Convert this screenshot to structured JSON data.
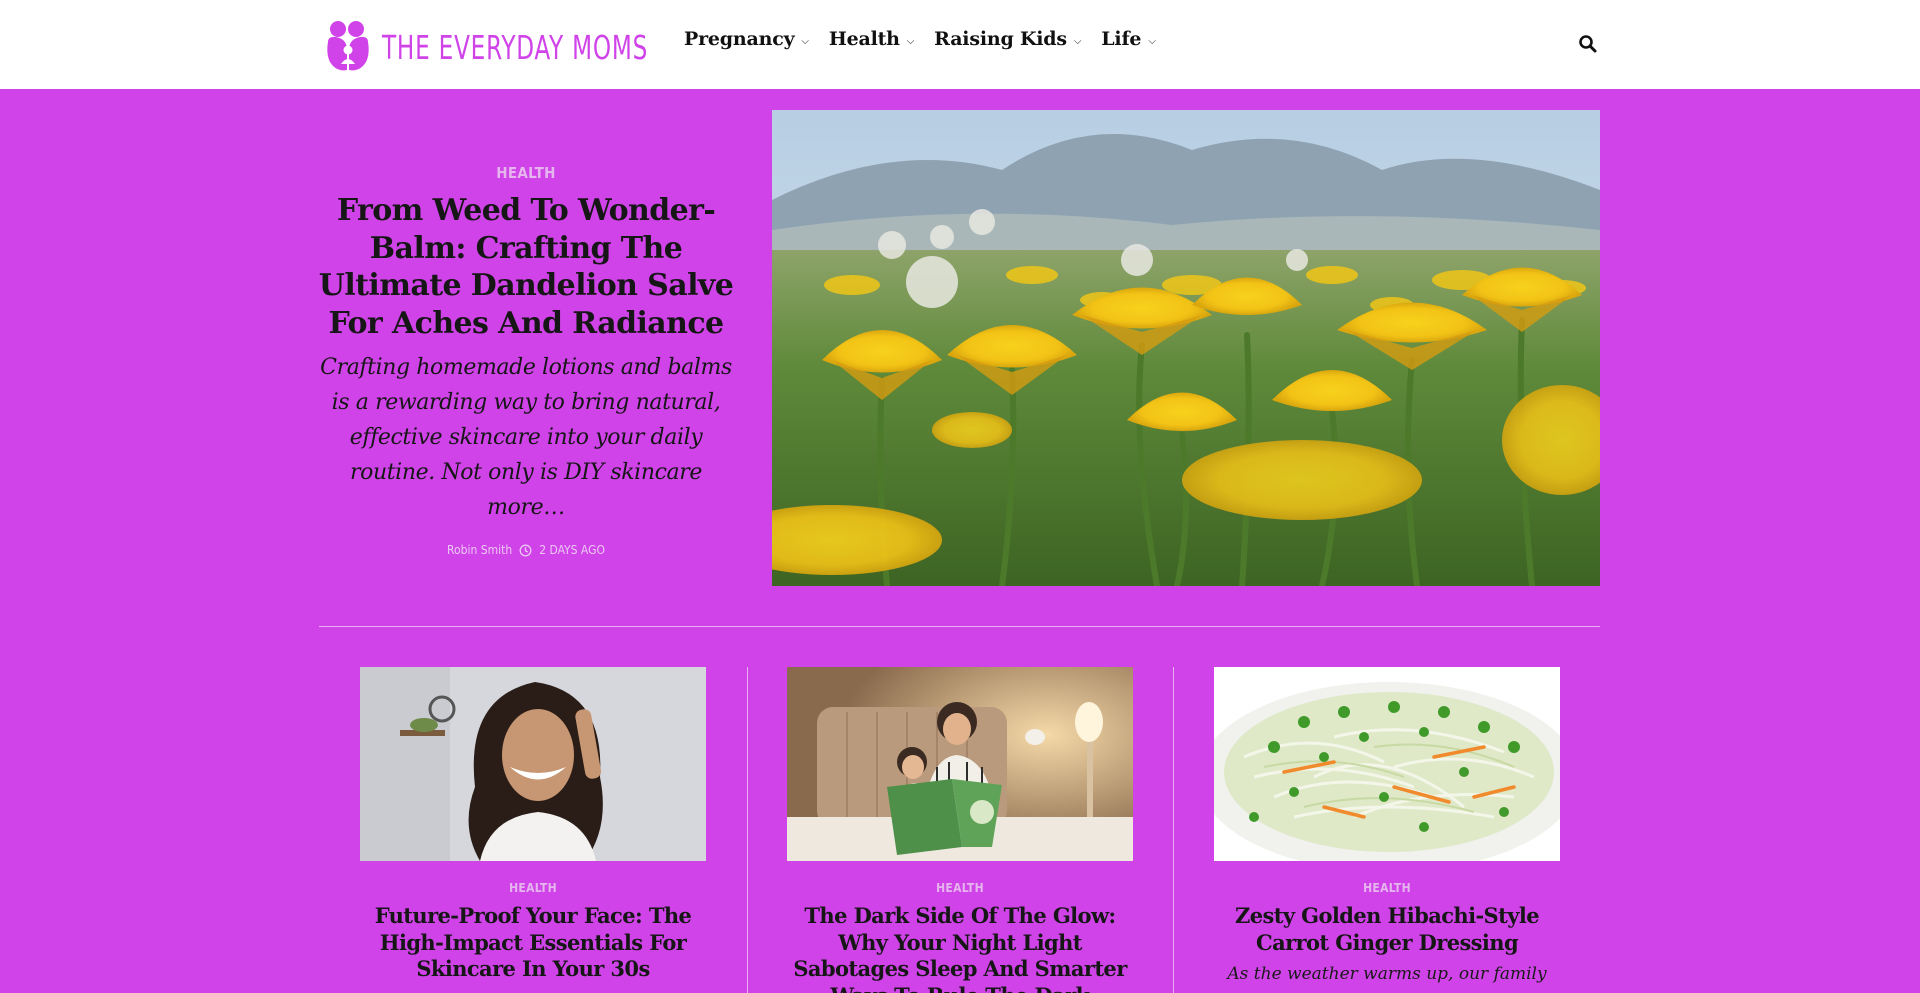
{
  "brand": {
    "name": "THE EVERYDAY MOMS",
    "color": "#d043e9"
  },
  "nav": {
    "items": [
      {
        "label": "Pregnancy",
        "chevron": "⌵"
      },
      {
        "label": "Health",
        "chevron": "⌵"
      },
      {
        "label": "Raising Kids",
        "chevron": "⌵"
      },
      {
        "label": "Life",
        "chevron": "⌵"
      }
    ],
    "search_icon": "search-icon"
  },
  "hero": {
    "category": "HEALTH",
    "title": "From Weed To Wonder-Balm: Crafting The Ultimate Dandelion Salve For Aches And Radiance",
    "excerpt": "Crafting homemade lotions and balms is a rewarding way to bring natural, effective skincare into your daily routine. Not only is DIY skincare more…",
    "author": "Robin Smith",
    "time": "2 DAYS AGO",
    "image": "dandelion-field"
  },
  "cards": [
    {
      "category": "HEALTH",
      "title": "Future-Proof Your Face: The High-Impact Essentials For Skincare In Your 30s",
      "excerpt": "",
      "image": "smiling-woman"
    },
    {
      "category": "HEALTH",
      "title": "The Dark Side Of The Glow: Why Your Night Light Sabotages Sleep And Smarter Ways To Rule The Dark",
      "excerpt": "",
      "image": "mother-reading-to-daughter"
    },
    {
      "category": "HEALTH",
      "title": "Zesty Golden Hibachi-Style Carrot Ginger Dressing",
      "excerpt": "As the weather warms up, our family",
      "image": "cabbage-salad"
    }
  ],
  "colors": {
    "background": "#d043e9",
    "header": "#ffffff",
    "category": "#e6b5ee"
  }
}
